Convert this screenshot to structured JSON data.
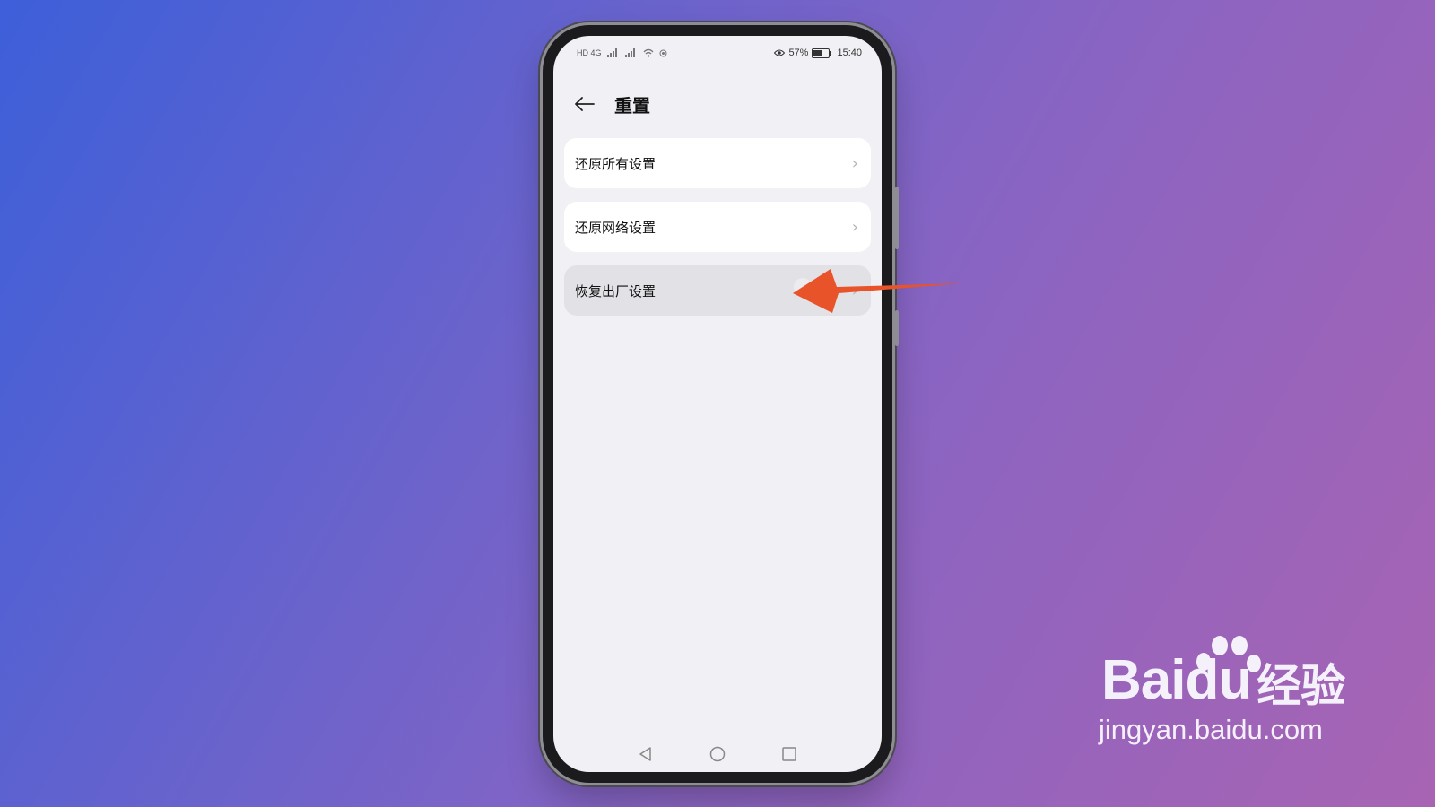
{
  "status_bar": {
    "eye_battery": "57%",
    "time": "15:40",
    "left_icons": "HD 4G"
  },
  "header": {
    "title": "重置"
  },
  "menu": {
    "items": [
      {
        "label": "还原所有设置"
      },
      {
        "label": "还原网络设置"
      },
      {
        "label": "恢复出厂设置"
      }
    ]
  },
  "battery_level": 0.57,
  "watermark": {
    "brand_left": "Bai",
    "brand_mid": "du",
    "brand_right": "经验",
    "url": "jingyan.baidu.com"
  },
  "colors": {
    "arrow": "#e8532a",
    "background_start": "#3d5fd9",
    "background_end": "#a864b3"
  }
}
